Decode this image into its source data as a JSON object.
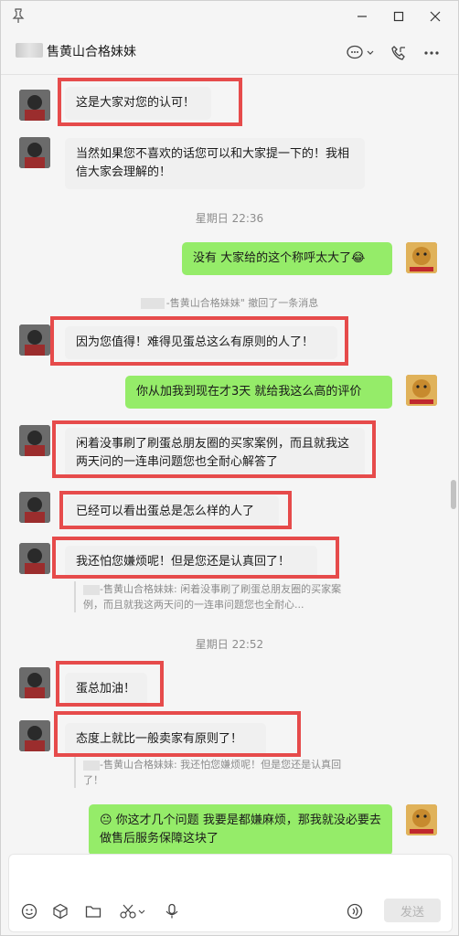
{
  "chat": {
    "title": "售黄山合格妹妹"
  },
  "messages": [
    {
      "dir": "in",
      "text": "这是大家对您的认可！"
    },
    {
      "dir": "in",
      "text": "当然如果您不喜欢的话您可以和大家提一下的！我相信大家会理解的！"
    },
    {
      "time": "星期日 22:36"
    },
    {
      "dir": "out",
      "text": "没有  大家给的这个称呼太大了😂"
    },
    {
      "system": "-售黄山合格妹妹\" 撤回了一条消息"
    },
    {
      "dir": "in",
      "text": "因为您值得！难得见蛋总这么有原则的人了！"
    },
    {
      "dir": "out",
      "text": "你从加我到现在才3天   就给我这么高的评价"
    },
    {
      "dir": "in",
      "text": "闲着没事刷了刷蛋总朋友圈的买家案例，而且就我这两天问的一连串问题您也全耐心解答了"
    },
    {
      "dir": "in",
      "text": "已经可以看出蛋总是怎么样的人了"
    },
    {
      "dir": "in",
      "text": "我还怕您嫌烦呢！但是您还是认真回了！"
    },
    {
      "quote": "-售黄山合格妹妹: 闲着没事刷了刷蛋总朋友圈的买家案例，而且就我这两天问的一连串问题您也全耐心..."
    },
    {
      "time": "星期日 22:52"
    },
    {
      "dir": "in",
      "text": "蛋总加油！"
    },
    {
      "dir": "in",
      "text": "态度上就比一般卖家有原则了！"
    },
    {
      "quote": "-售黄山合格妹妹: 我还怕您嫌烦呢！但是您还是认真回了！"
    },
    {
      "dir": "out",
      "text": "😐 你这才几个问题  我要是都嫌麻烦，那我就没必要去做售后服务保障这块了"
    }
  ],
  "input": {
    "send_label": "发送"
  },
  "icons": [
    "pin-icon",
    "minimize-icon",
    "maximize-icon",
    "close-icon",
    "chat-bubble-icon",
    "phone-icon",
    "more-icon",
    "emoji-icon",
    "sticker-icon",
    "folder-icon",
    "scissors-icon",
    "mic-icon",
    "voice-input-icon"
  ],
  "colors": {
    "incoming_bubble": "#ffffff",
    "outgoing_bubble": "#95ec69",
    "highlight_box": "#e64b4b",
    "background": "#f5f5f5"
  }
}
